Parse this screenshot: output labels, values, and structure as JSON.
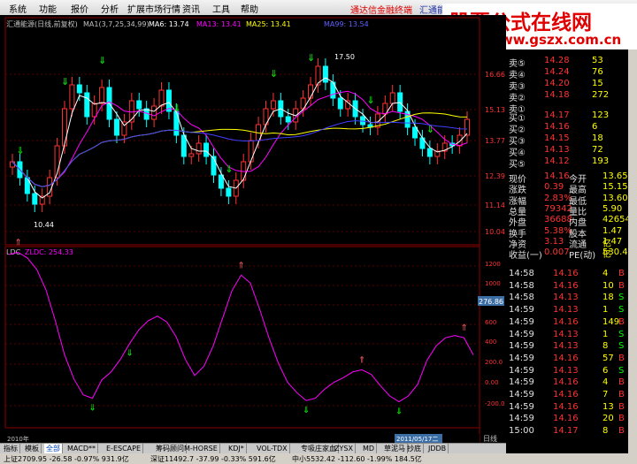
{
  "menu": [
    "系统",
    "功能",
    "报价",
    "分析",
    "扩展市场行情",
    "资讯",
    "工具",
    "帮助"
  ],
  "news_red": "通达信金融终端",
  "news_blue": "汇通能",
  "brand": {
    "title": "股票公式在线网",
    "url": "www.gszx.com.cn"
  },
  "header": {
    "title": "汇通能源(日线,前复权)",
    "ma1": "MA1(3,7,25,34,99)",
    "ma6": "MA6: 13.74",
    "ma13": "MA13: 13.41",
    "ma25": "MA25: 13.41",
    "ma99": "MA99: 13.54"
  },
  "price_axis": [
    "16.66",
    "15.13",
    "13.77",
    "12.39",
    "11.14",
    "10.04"
  ],
  "price_labels": {
    "high": "17.50",
    "low": "10.44"
  },
  "indicator": {
    "name": "LDC",
    "formula": "ZLDC: 254.33",
    "current_value": "276.86"
  },
  "indicator_axis": [
    "1200",
    "1000",
    "800",
    "600",
    "400",
    "200.0",
    "0.00",
    "-200.0"
  ],
  "chart_data": {
    "type": "line",
    "series": [
      {
        "name": "ZLDC",
        "x": [
          0,
          1,
          2,
          3,
          4,
          5,
          6,
          7,
          8,
          9,
          10,
          11,
          12,
          13,
          14,
          15,
          16,
          17,
          18,
          19,
          20,
          21,
          22,
          23,
          24,
          25,
          26,
          27,
          28,
          29,
          30,
          31,
          32,
          33,
          34,
          35,
          36,
          37,
          38,
          39,
          40,
          41,
          42,
          43,
          44,
          45,
          46,
          47,
          48,
          49,
          50
        ],
        "values": [
          1180,
          1200,
          1150,
          1050,
          870,
          600,
          300,
          90,
          -50,
          -80,
          80,
          150,
          260,
          400,
          520,
          600,
          640,
          590,
          460,
          260,
          120,
          200,
          380,
          620,
          860,
          1000,
          930,
          700,
          450,
          230,
          60,
          -30,
          -100,
          -80,
          0,
          60,
          100,
          150,
          170,
          130,
          30,
          -60,
          -110,
          -60,
          40,
          250,
          380,
          450,
          470,
          450,
          300
        ]
      }
    ],
    "ylim": [
      -300,
      1250
    ]
  },
  "quotes": {
    "sell": [
      {
        "label": "卖⑤",
        "price": "14.28",
        "vol": "53"
      },
      {
        "label": "卖④",
        "price": "14.24",
        "vol": "76"
      },
      {
        "label": "卖③",
        "price": "14.20",
        "vol": "15"
      },
      {
        "label": "卖②",
        "price": "14.18",
        "vol": "272"
      },
      {
        "label": "卖①",
        "price": "",
        "vol": ""
      }
    ],
    "buy": [
      {
        "label": "买①",
        "price": "14.17",
        "vol": "123"
      },
      {
        "label": "买②",
        "price": "14.16",
        "vol": "6"
      },
      {
        "label": "买③",
        "price": "14.15",
        "vol": "18"
      },
      {
        "label": "买④",
        "price": "14.13",
        "vol": "72"
      },
      {
        "label": "买⑤",
        "price": "14.12",
        "vol": "193"
      }
    ],
    "stats": [
      {
        "l1": "现价",
        "v1": "14.16",
        "l2": "今开",
        "v2": "13.65"
      },
      {
        "l1": "涨跌",
        "v1": "0.39",
        "l2": "最高",
        "v2": "15.15"
      },
      {
        "l1": "涨幅",
        "v1": "2.83%",
        "l2": "最低",
        "v2": "13.60"
      },
      {
        "l1": "总量",
        "v1": "79342",
        "l2": "量比",
        "v2": "5.90"
      },
      {
        "l1": "外盘",
        "v1": "36688",
        "l2": "内盘",
        "v2": "42654"
      },
      {
        "l1": "换手",
        "v1": "5.38%",
        "l2": "股本",
        "v2": "1.47亿"
      },
      {
        "l1": "净资",
        "v1": "3.13",
        "l2": "流通",
        "v2": "1.47亿"
      },
      {
        "l1": "收益(一)",
        "v1": "0.007",
        "l2": "PE(动)",
        "v2": "530.4"
      }
    ],
    "ticks": [
      {
        "time": "14:58",
        "price": "14.16",
        "vol": "4",
        "flag": "B"
      },
      {
        "time": "14:58",
        "price": "14.16",
        "vol": "10",
        "flag": "B"
      },
      {
        "time": "14:58",
        "price": "14.13",
        "vol": "18",
        "flag": "S"
      },
      {
        "time": "14:59",
        "price": "14.13",
        "vol": "1",
        "flag": "S"
      },
      {
        "time": "14:59",
        "price": "14.16",
        "vol": "149",
        "flag": "B"
      },
      {
        "time": "14:59",
        "price": "14.13",
        "vol": "1",
        "flag": "S"
      },
      {
        "time": "14:59",
        "price": "14.13",
        "vol": "8",
        "flag": "S"
      },
      {
        "time": "14:59",
        "price": "14.16",
        "vol": "57",
        "flag": "B"
      },
      {
        "time": "14:59",
        "price": "14.13",
        "vol": "6",
        "flag": "S"
      },
      {
        "time": "14:59",
        "price": "14.16",
        "vol": "4",
        "flag": "B"
      },
      {
        "time": "14:59",
        "price": "14.16",
        "vol": "7",
        "flag": "B"
      },
      {
        "time": "14:59",
        "price": "14.16",
        "vol": "13",
        "flag": "B"
      },
      {
        "time": "14:59",
        "price": "14.16",
        "vol": "20",
        "flag": "B"
      },
      {
        "time": "15:00",
        "price": "14.17",
        "vol": "8",
        "flag": "B"
      }
    ]
  },
  "date_left": "2010年",
  "date_mid": "2011/05/17二",
  "period_label": "日线",
  "bottom_tabs": [
    "指标",
    "模板",
    "全部",
    "MACD**",
    "E-ESCAPE",
    "筹码顾问",
    "M-HORSE",
    "KDJ*",
    "VOL-TDX",
    "专吸庄家血",
    "ZYSX",
    "MD",
    "草泥马",
    "抄底",
    "JDDB"
  ],
  "status": {
    "sh": "上证2709.95 -26.58 -0.97% 931.9亿",
    "sz": "深证11492.7 -37.99 -0.33% 591.6亿",
    "zx": "中小5532.42 -112.60 -1.99% 184.5亿"
  },
  "colors": {
    "up": "#ff3232",
    "down": "#00ffff",
    "ma_white": "#ffffff",
    "ma_yellow": "#ffff00",
    "ma_purple": "#ff00ff",
    "ma_blue": "#4040ff",
    "grid": "#8b0000"
  }
}
